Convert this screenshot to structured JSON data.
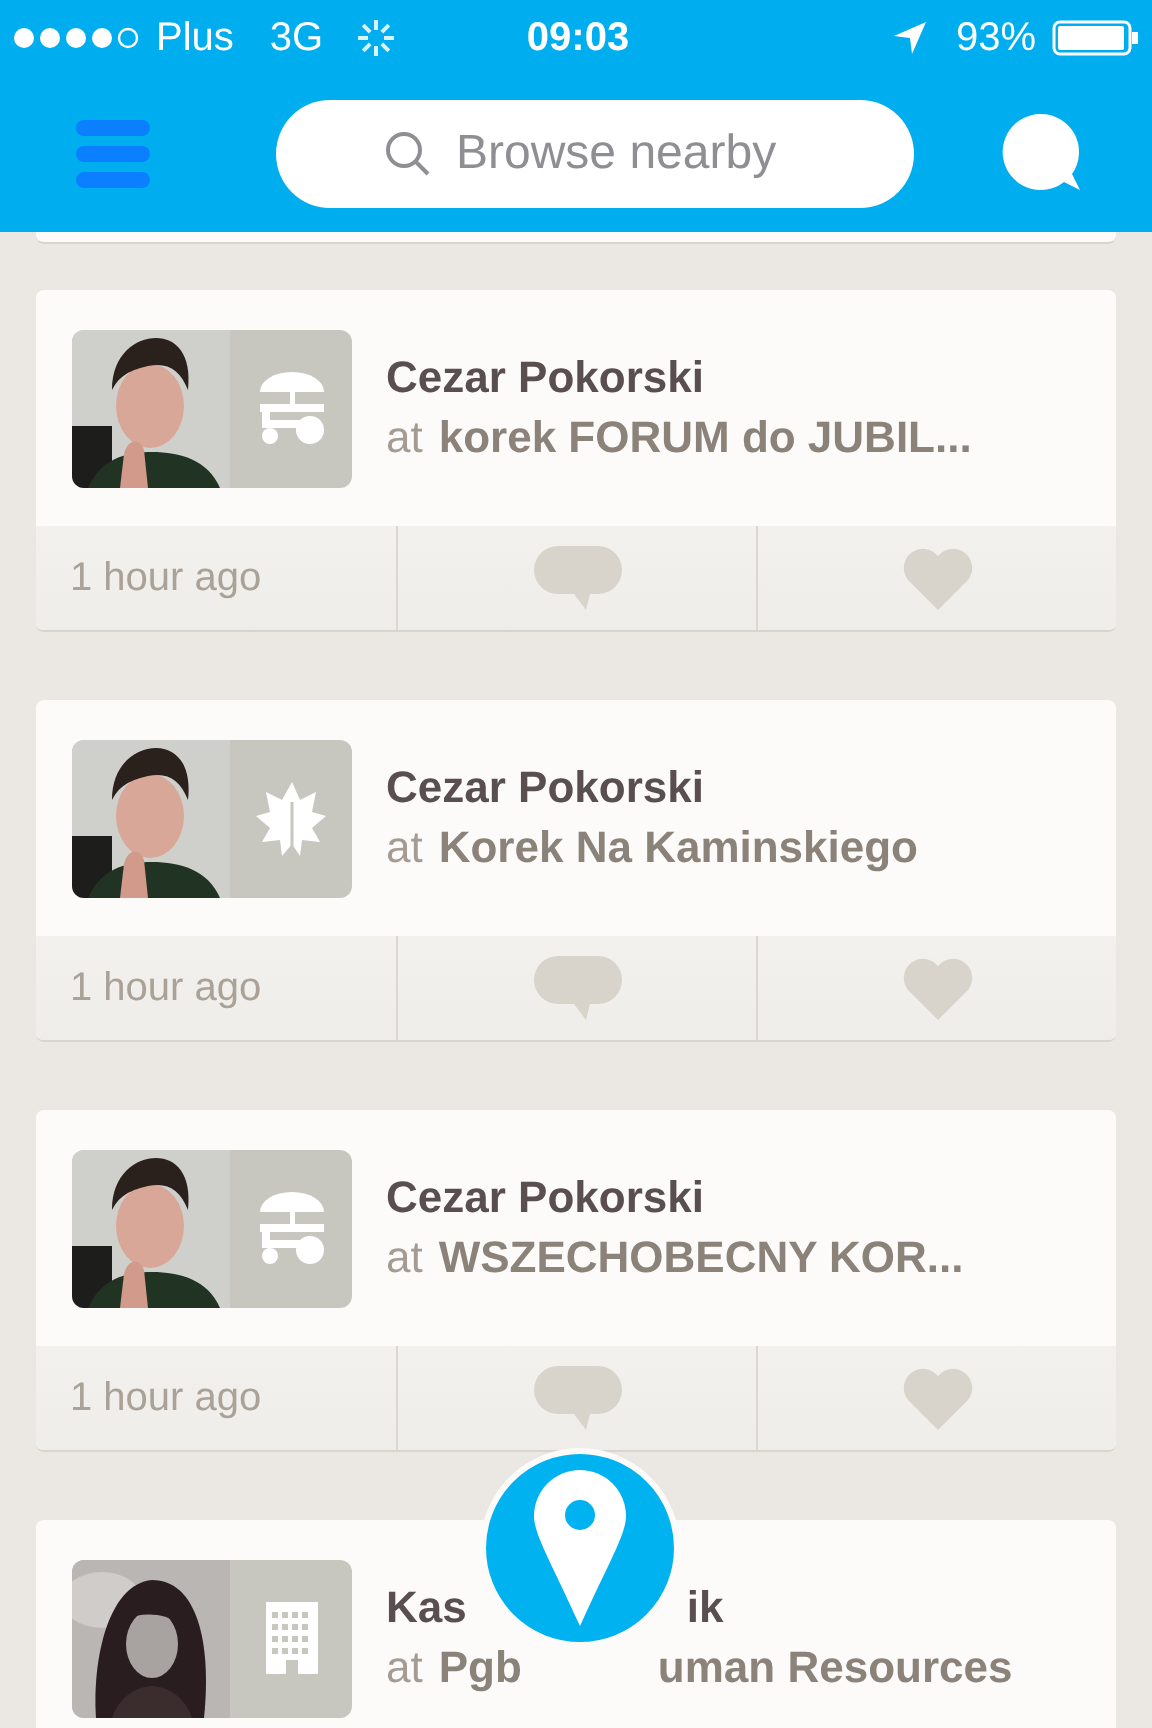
{
  "status_bar": {
    "carrier": "Plus",
    "network": "3G",
    "time": "09:03",
    "battery": "93%"
  },
  "nav_bar": {
    "search": {
      "placeholder": "Browse nearby"
    }
  },
  "feed": [
    {
      "name": "Cezar Pokorski",
      "at": "at",
      "place": "korek FORUM do JUBIL...",
      "time": "1 hour ago",
      "kind": "cart"
    },
    {
      "name": "Cezar Pokorski",
      "at": "at",
      "place": "Korek Na Kaminskiego",
      "time": "1 hour ago",
      "kind": "leaf"
    },
    {
      "name": "Cezar Pokorski",
      "at": "at",
      "place": "WSZECHOBECNY KOR...",
      "time": "1 hour ago",
      "kind": "cart"
    },
    {
      "name_parts": [
        "Kas",
        "ik"
      ],
      "at": "at",
      "place_parts": [
        "Pgb",
        "uman Resources"
      ],
      "kind": "building"
    }
  ]
}
